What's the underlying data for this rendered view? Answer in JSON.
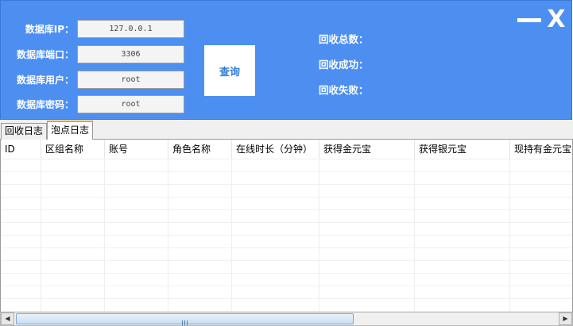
{
  "connection": {
    "ip": {
      "label": "数据库IP：",
      "value": "127.0.0.1"
    },
    "port": {
      "label": "数据库端口：",
      "value": "3306"
    },
    "user": {
      "label": "数据库用户：",
      "value": "root"
    },
    "password": {
      "label": "数据库密码：",
      "value": "root"
    }
  },
  "query_button": "查询",
  "stats": {
    "total": "回收总数：",
    "success": "回收成功：",
    "failed": "回收失败："
  },
  "window_controls": {
    "minimize_icon": "minimize-icon",
    "close_icon": "close-icon",
    "close_glyph": "X"
  },
  "tabs": [
    {
      "label": "回收日志",
      "active": false
    },
    {
      "label": "泡点日志",
      "active": true
    }
  ],
  "table": {
    "columns": [
      "ID",
      "区组名称",
      "账号",
      "角色名称",
      "在线时长（分钟）",
      "获得金元宝",
      "获得银元宝",
      "现持有金元宝"
    ],
    "rows": []
  },
  "scrollbar": {
    "grip_icon": "grip-icon"
  },
  "colors": {
    "header_bg": "#4d8ff0",
    "tab_accent": "#e8a322",
    "button_text": "#2f7dd6"
  }
}
